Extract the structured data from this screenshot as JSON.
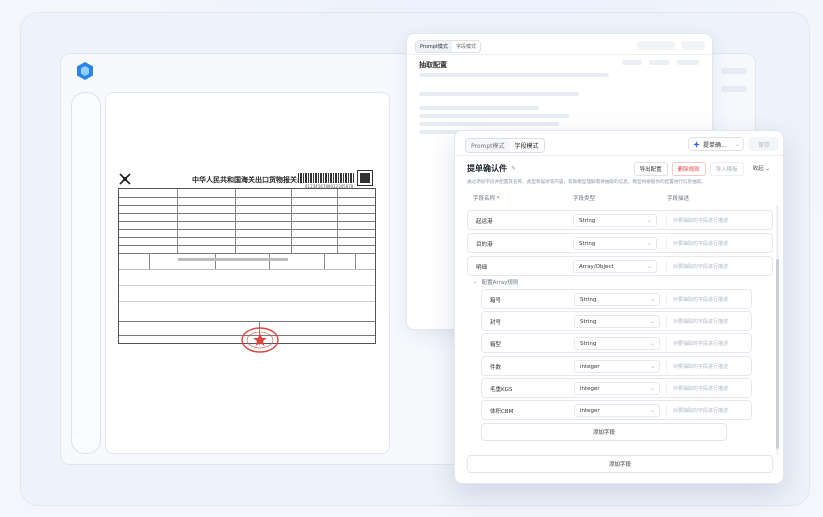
{
  "colors": {
    "accent": "#2f6bff",
    "danger": "#e0443c",
    "logo": "#2a83e8"
  },
  "document": {
    "title": "中华人民共和国海关出口货物报关单",
    "number": "6123456789012345678"
  },
  "back_window": {
    "tabs": [
      {
        "label": "Prompt模式"
      },
      {
        "label": "字段模式"
      }
    ],
    "title": "抽取配置"
  },
  "front_window": {
    "tabs": [
      {
        "label": "Prompt模式"
      },
      {
        "label": "字段模式"
      }
    ],
    "model_select": "提单确...",
    "save_button": "保存",
    "rule_title": "提单确认件",
    "actions": {
      "export": "导出配置",
      "delete": "删除规则",
      "import": "导入模板",
      "collapse": "收起"
    },
    "description": "通过添加字段并配置其名称、类型和描述等内容，帮助模型理解需要抽取的信息。模型将根据你的配置进行信息抽取。",
    "columns": {
      "name": "字段名称",
      "required_mark": "*",
      "type": "字段类型",
      "desc": "字段描述"
    },
    "desc_placeholder": "对要抽取的字段进行描述",
    "fields": [
      {
        "name": "起运港",
        "type": "String"
      },
      {
        "name": "目的港",
        "type": "String"
      },
      {
        "name": "明细",
        "type": "Array/Object"
      }
    ],
    "sub_section_label": "配置Array规则",
    "sub_fields": [
      {
        "name": "箱号",
        "type": "String"
      },
      {
        "name": "封号",
        "type": "String"
      },
      {
        "name": "箱型",
        "type": "String"
      },
      {
        "name": "件数",
        "type": "integer"
      },
      {
        "name": "毛重KGS",
        "type": "integer"
      },
      {
        "name": "体积CBM",
        "type": "integer"
      }
    ],
    "add_sub_field": "添加字段",
    "add_field": "添加字段"
  }
}
